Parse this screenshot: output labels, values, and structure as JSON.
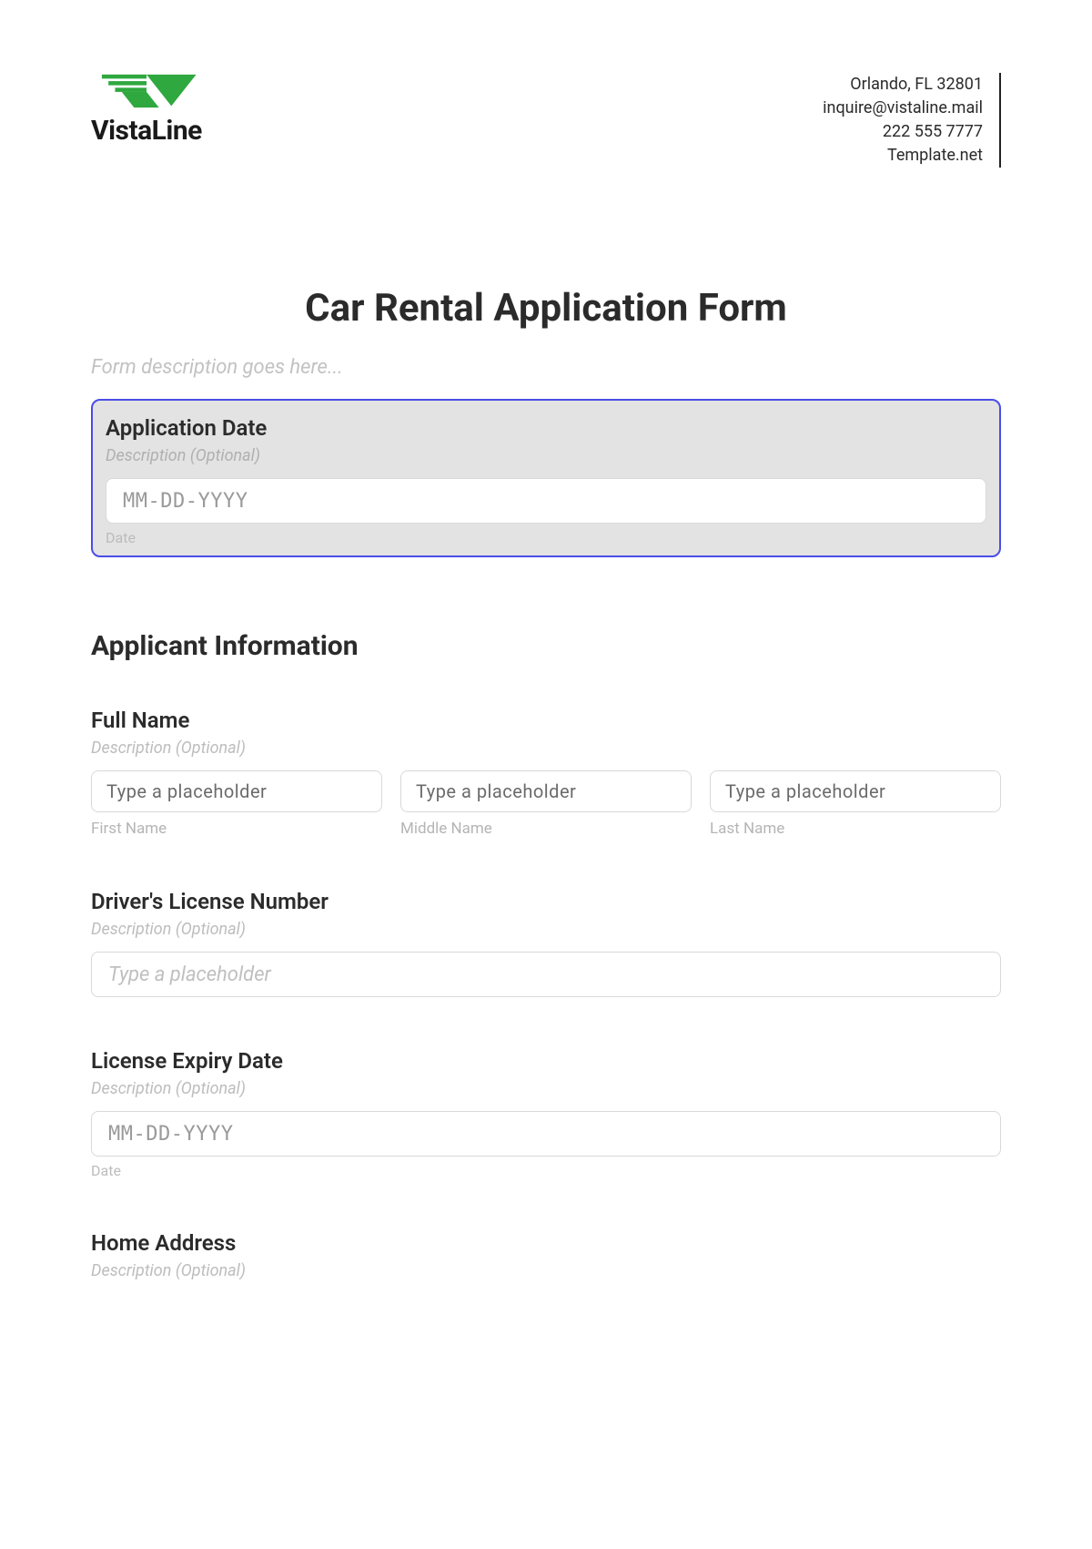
{
  "brand": {
    "name": "VistaLine"
  },
  "contact": {
    "address": "Orlando, FL 32801",
    "email": "inquire@vistaline.mail",
    "phone": "222 555 7777",
    "site": "Template.net"
  },
  "form": {
    "title": "Car Rental Application Form",
    "description_placeholder": "Form description goes here..."
  },
  "application_date": {
    "label": "Application Date",
    "desc_placeholder": "Description (Optional)",
    "input_placeholder": "MM-DD-YYYY",
    "sublabel": "Date"
  },
  "section_applicant": {
    "heading": "Applicant Information"
  },
  "full_name": {
    "label": "Full Name",
    "desc_placeholder": "Description (Optional)",
    "cols": [
      {
        "placeholder": "Type a placeholder",
        "sublabel": "First Name"
      },
      {
        "placeholder": "Type a placeholder",
        "sublabel": "Middle Name"
      },
      {
        "placeholder": "Type a placeholder",
        "sublabel": "Last Name"
      }
    ]
  },
  "license_number": {
    "label": "Driver's License Number",
    "desc_placeholder": "Description (Optional)",
    "input_placeholder": "Type a placeholder"
  },
  "license_expiry": {
    "label": "License Expiry Date",
    "desc_placeholder": "Description (Optional)",
    "input_placeholder": "MM-DD-YYYY",
    "sublabel": "Date"
  },
  "home_address": {
    "label": "Home Address",
    "desc_placeholder": "Description (Optional)"
  }
}
